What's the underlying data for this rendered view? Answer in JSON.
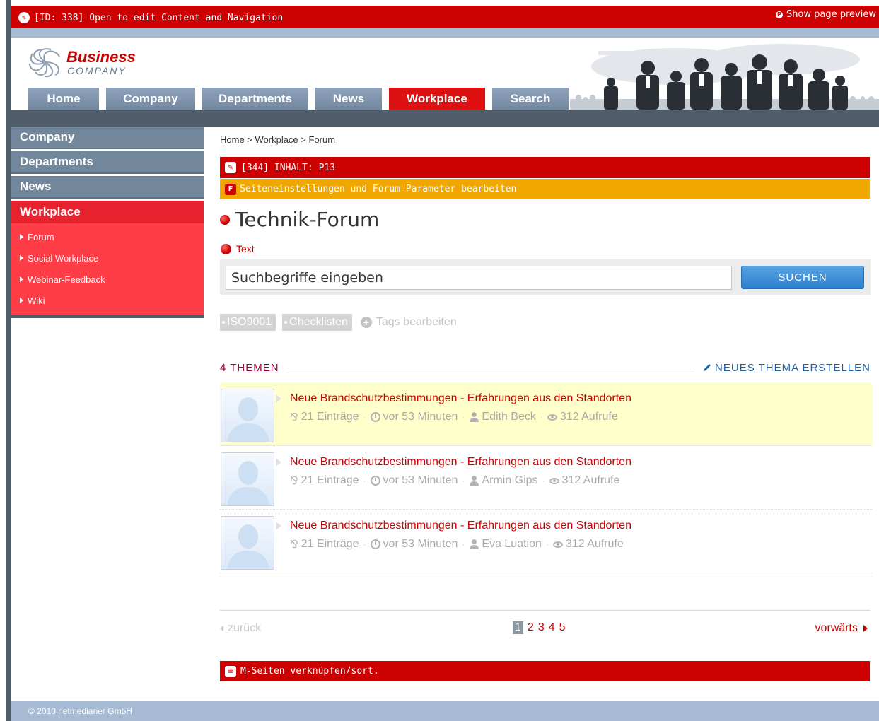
{
  "editbar": {
    "label": "[ID: 338] Open to edit Content and Navigation",
    "preview": "Show page preview"
  },
  "logo": {
    "line1": "Business",
    "line2": "COMPANY"
  },
  "topnav": [
    "Home",
    "Company",
    "Departments",
    "News",
    "Workplace",
    "Search"
  ],
  "sidebar": {
    "items": [
      "Company",
      "Departments",
      "News",
      "Workplace"
    ],
    "sub": [
      "Forum",
      "Social Workplace",
      "Webinar-Feedback",
      "Wiki"
    ]
  },
  "breadcrumb": "Home > Workplace > Forum",
  "content_bar": "[344] INHALT: P13",
  "settings_bar": "Seiteneinstellungen und Forum-Parameter bearbeiten",
  "title": "Technik-Forum",
  "text_link": "Text",
  "search": {
    "placeholder": "Suchbegriffe eingeben",
    "button": "SUCHEN"
  },
  "tags": {
    "items": [
      "ISO9001",
      "Checklisten"
    ],
    "edit": "Tags bearbeiten"
  },
  "themen": {
    "count": "4 THEMEN",
    "new": "NEUES THEMA ERSTELLEN"
  },
  "topics": [
    {
      "title": "Neue Brandschutzbestimmungen - Erfahrungen aus den Standorten",
      "entries": "21 Einträge",
      "time": "vor 53 Minuten",
      "author": "Edith Beck",
      "views": "312 Aufrufe",
      "highlight": true
    },
    {
      "title": "Neue Brandschutzbestimmungen - Erfahrungen aus den Standorten",
      "entries": "21 Einträge",
      "time": "vor 53 Minuten",
      "author": "Armin Gips",
      "views": "312 Aufrufe",
      "highlight": false
    },
    {
      "title": "Neue Brandschutzbestimmungen - Erfahrungen aus den Standorten",
      "entries": "21 Einträge",
      "time": "vor 53 Minuten",
      "author": "Eva Luation",
      "views": "312 Aufrufe",
      "highlight": false
    }
  ],
  "pager": {
    "prev": "zurück",
    "pages": [
      "1",
      "2",
      "3",
      "4",
      "5"
    ],
    "next": "vorwärts"
  },
  "bottom_bar": "M-Seiten verknüpfen/sort.",
  "footer": "© 2010 netmedianer GmbH",
  "colors": {
    "brand_red": "#cc0000",
    "nav_blue": "#73879c",
    "orange": "#f0a800",
    "button_blue": "#2d7fcd"
  }
}
